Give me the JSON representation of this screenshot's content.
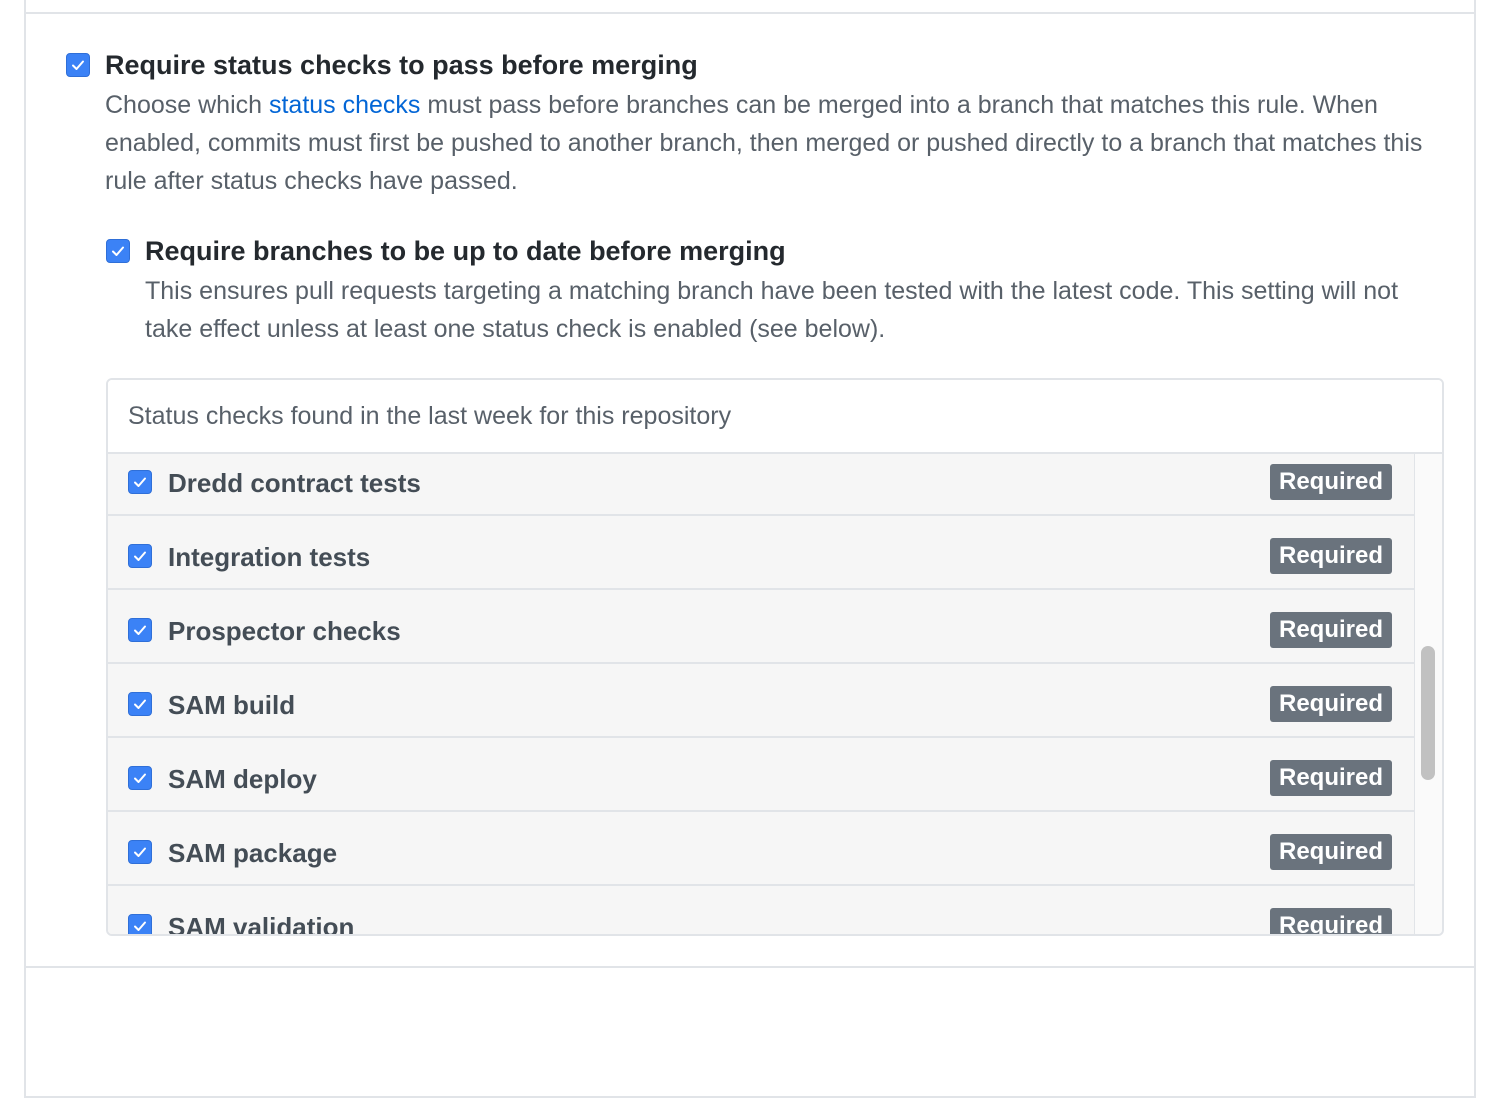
{
  "rule": {
    "title": "Require status checks to pass before merging",
    "desc_before_link": "Choose which ",
    "desc_link": "status checks",
    "desc_after_link": " must pass before branches can be merged into a branch that matches this rule. When enabled, commits must first be pushed to another branch, then merged or pushed directly to a branch that matches this rule after status checks have passed.",
    "checked": true
  },
  "subrule": {
    "title": "Require branches to be up to date before merging",
    "desc": "This ensures pull requests targeting a matching branch have been tested with the latest code. This setting will not take effect unless at least one status check is enabled (see below).",
    "checked": true
  },
  "status_checks": {
    "header": "Status checks found in the last week for this repository",
    "items": [
      {
        "label": "Dredd contract tests",
        "badge": "Required",
        "checked": true
      },
      {
        "label": "Integration tests",
        "badge": "Required",
        "checked": true
      },
      {
        "label": "Prospector checks",
        "badge": "Required",
        "checked": true
      },
      {
        "label": "SAM build",
        "badge": "Required",
        "checked": true
      },
      {
        "label": "SAM deploy",
        "badge": "Required",
        "checked": true
      },
      {
        "label": "SAM package",
        "badge": "Required",
        "checked": true
      },
      {
        "label": "SAM validation",
        "badge": "Required",
        "checked": true
      }
    ]
  },
  "colors": {
    "checkbox": "#3b82f6",
    "link": "#0366d6",
    "badge": "#6a737d"
  }
}
